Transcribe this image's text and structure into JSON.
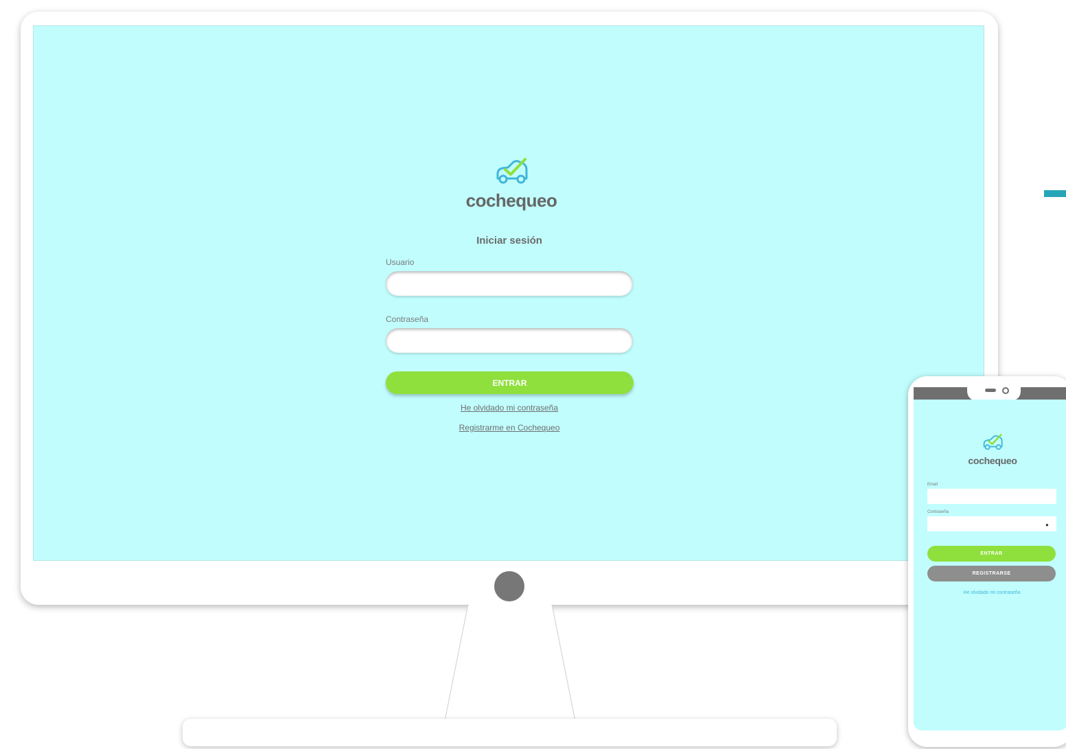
{
  "desktop": {
    "logo_text": "cochequeo",
    "form_title": "Iniciar sesión",
    "username_label": "Usuario",
    "username_value": "",
    "password_label": "Contraseña",
    "password_value": "",
    "submit_label": "ENTRAR",
    "forgot_link": "He olvidado mi contraseña",
    "register_link": "Registrarme en Cochequeo"
  },
  "mobile": {
    "logo_text": "cochequeo",
    "email_label": "Email",
    "email_value": "",
    "password_label": "Contraseña",
    "password_value": "",
    "password_toggle_icon": "eye-icon",
    "submit_label": "ENTRAR",
    "register_label": "REGISTRARSE",
    "forgot_link": "He olvidado mi contraseña"
  },
  "colors": {
    "screen_background": "#c1fdfd",
    "primary_button": "#8fe03c",
    "secondary_button": "#8e8e8e",
    "accent": "#25a6b8",
    "link_mobile": "#3fb6d9",
    "logo_car_stroke": "#3fb6d9",
    "logo_check": "#8fe03c"
  }
}
